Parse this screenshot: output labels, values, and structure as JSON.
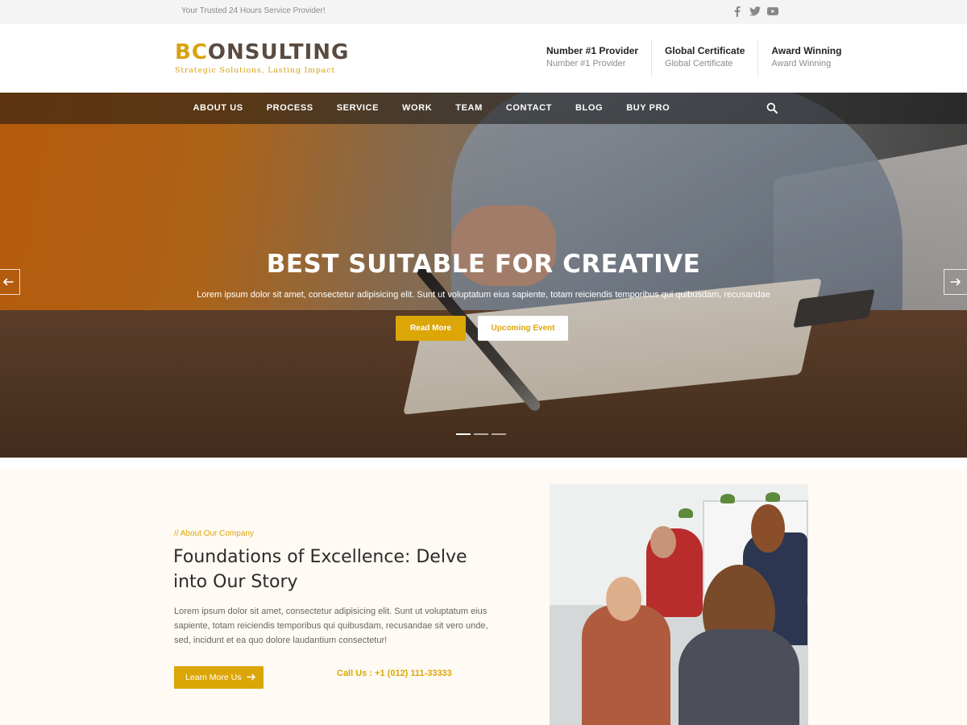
{
  "topbar": {
    "tagline": "Your Trusted 24 Hours Service Provider!",
    "social": [
      "facebook-icon",
      "twitter-icon",
      "youtube-icon"
    ]
  },
  "header": {
    "logo_bc": "BC",
    "logo_rest": "ONSULTING",
    "logo_tagline": "Strategic Solutions, Lasting Impact",
    "features": [
      {
        "title": "Number #1 Provider",
        "subtitle": "Number #1 Provider"
      },
      {
        "title": "Global Certificate",
        "subtitle": "Global Certificate"
      },
      {
        "title": "Award Winning",
        "subtitle": "Award Winning"
      }
    ]
  },
  "nav": {
    "items": [
      "ABOUT US",
      "PROCESS",
      "SERVICE",
      "WORK",
      "TEAM",
      "CONTACT",
      "BLOG",
      "BUY PRO"
    ],
    "search_icon": "search-icon"
  },
  "hero": {
    "title": "BEST SUITABLE FOR CREATIVE",
    "text": "Lorem ipsum dolor sit amet, consectetur adipisicing elit. Sunt ut voluptatum eius sapiente, totam reiciendis temporibus qui quibusdam, recusandae",
    "read_more": "Read More",
    "upcoming_event": "Upcoming Event",
    "slides": 3,
    "active_slide": 1
  },
  "about": {
    "eyebrow": "// About Our Company",
    "heading": "Foundations of Excellence: Delve into Our Story",
    "paragraph": "Lorem ipsum dolor sit amet, consectetur adipisicing elit. Sunt ut voluptatum eius sapiente, totam reiciendis temporibus qui quibusdam, recusandae sit vero unde, sed, incidunt et ea quo dolore laudantium consectetur!",
    "learn_more": "Learn More Us",
    "call": "Call Us : +1 (012) 111-33333"
  },
  "colors": {
    "accent": "#dca607",
    "logo_dark": "#5a4a3f",
    "about_bg": "#fffaf3"
  }
}
